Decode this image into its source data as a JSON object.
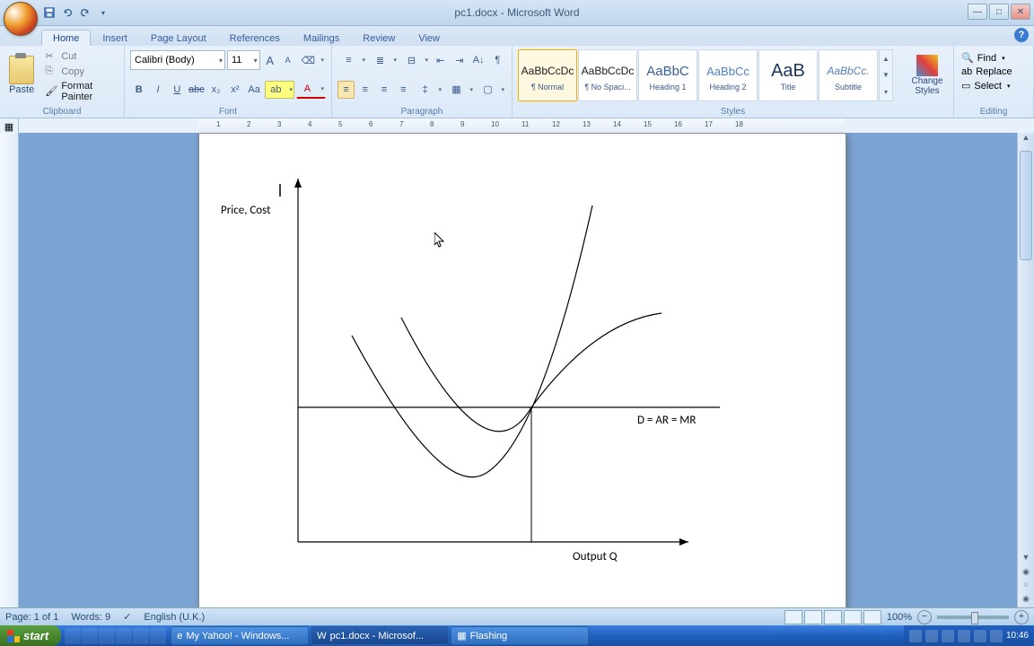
{
  "window": {
    "title": "pc1.docx - Microsoft Word"
  },
  "qat": {
    "save": "save",
    "undo": "undo",
    "redo": "redo"
  },
  "tabs": [
    "Home",
    "Insert",
    "Page Layout",
    "References",
    "Mailings",
    "Review",
    "View"
  ],
  "active_tab": "Home",
  "clipboard": {
    "paste": "Paste",
    "cut": "Cut",
    "copy": "Copy",
    "format_painter": "Format Painter",
    "label": "Clipboard"
  },
  "font": {
    "name": "Calibri (Body)",
    "size": "11",
    "label": "Font"
  },
  "paragraph": {
    "label": "Paragraph"
  },
  "styles": {
    "items": [
      {
        "preview": "AaBbCcDc",
        "name": "¶ Normal",
        "selected": true,
        "size": "11px",
        "color": "#000"
      },
      {
        "preview": "AaBbCcDc",
        "name": "¶ No Spaci...",
        "selected": false,
        "size": "11px",
        "color": "#000"
      },
      {
        "preview": "AaBbC",
        "name": "Heading 1",
        "selected": false,
        "size": "15px",
        "color": "#365f91"
      },
      {
        "preview": "AaBbCc",
        "name": "Heading 2",
        "selected": false,
        "size": "13px",
        "color": "#4f81bd"
      },
      {
        "preview": "AaB",
        "name": "Title",
        "selected": false,
        "size": "20px",
        "color": "#17365d"
      },
      {
        "preview": "AaBbCc.",
        "name": "Subtitle",
        "selected": false,
        "size": "12px",
        "color": "#4f81bd"
      }
    ],
    "change": "Change Styles",
    "label": "Styles"
  },
  "editing": {
    "find": "Find",
    "replace": "Replace",
    "select": "Select",
    "label": "Editing"
  },
  "document": {
    "y_label": "Price, Cost",
    "x_label": "Output Q",
    "line_label": "D = AR = MR"
  },
  "status": {
    "page": "Page: 1 of 1",
    "words": "Words: 9",
    "lang": "English (U.K.)",
    "zoom": "100%"
  },
  "taskbar": {
    "start": "start",
    "tasks": [
      "My Yahoo! - Windows...",
      "pc1.docx - Microsof...",
      "Flashing"
    ],
    "clock": "10:46"
  },
  "ruler_ticks": [
    "1",
    "2",
    "3",
    "4",
    "5",
    "6",
    "7",
    "8",
    "9",
    "10",
    "11",
    "12",
    "13",
    "14",
    "15",
    "16",
    "17",
    "18"
  ]
}
